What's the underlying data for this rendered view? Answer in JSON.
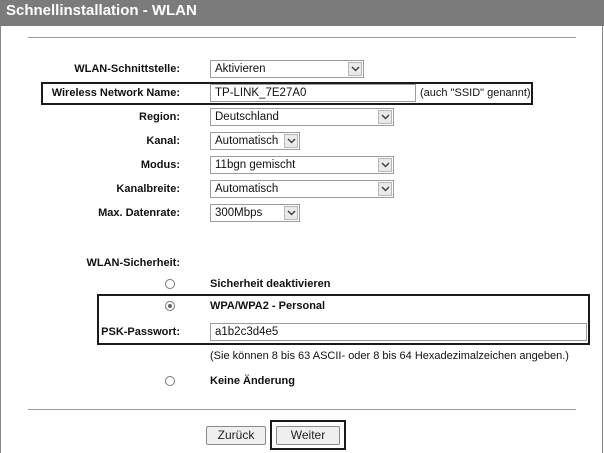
{
  "title": "Schnellinstallation - WLAN",
  "wlan": {
    "interface_label": "WLAN-Schnittstelle:",
    "interface_value": "Aktivieren",
    "ssid_label": "Wireless Network Name:",
    "ssid_value": "TP-LINK_7E27A0",
    "ssid_hint": "(auch \"SSID\" genannt)",
    "region_label": "Region:",
    "region_value": "Deutschland",
    "channel_label": "Kanal:",
    "channel_value": "Automatisch",
    "mode_label": "Modus:",
    "mode_value": "11bgn gemischt",
    "width_label": "Kanalbreite:",
    "width_value": "Automatisch",
    "rate_label": "Max. Datenrate:",
    "rate_value": "300Mbps"
  },
  "security": {
    "label": "WLAN-Sicherheit:",
    "opt_disable": "Sicherheit deaktivieren",
    "opt_wpa": "WPA/WPA2 - Personal",
    "psk_label": "PSK-Passwort:",
    "psk_value": "a1b2c3d4e5",
    "psk_hint": "(Sie können 8 bis 63 ASCII- oder 8 bis 64 Hexadezimalzeichen angeben.)",
    "opt_nochange": "Keine Änderung",
    "selected": "wpa"
  },
  "buttons": {
    "back": "Zurück",
    "next": "Weiter"
  }
}
